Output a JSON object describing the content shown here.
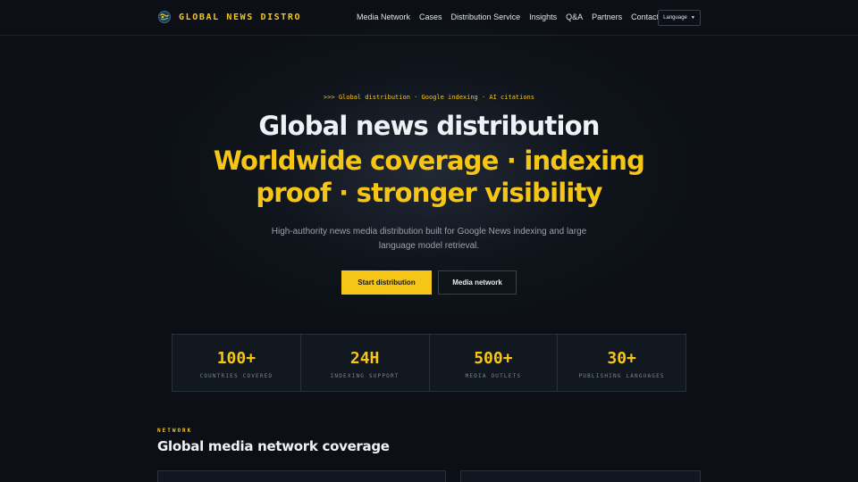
{
  "brand": {
    "name": "GLOBAL NEWS DISTRO",
    "logo_icon": "globe-icon"
  },
  "nav": {
    "items": [
      "Media Network",
      "Cases",
      "Distribution Service",
      "Insights",
      "Q&A",
      "Partners",
      "Contact"
    ],
    "language_label": "Language",
    "language_icon": "caret-down-icon"
  },
  "hero": {
    "eyebrow": ">>> Global distribution · Google indexing · AI citations",
    "title_line1": "Global news distribution",
    "title_line2": "Worldwide coverage · indexing",
    "title_line3": "proof · stronger visibility",
    "subtitle": "High-authority news media distribution built for Google News indexing and large language model retrieval.",
    "primary_button": "Start distribution",
    "secondary_button": "Media network"
  },
  "stats": [
    {
      "value": "100+",
      "label": "COUNTRIES COVERED"
    },
    {
      "value": "24H",
      "label": "INDEXING SUPPORT"
    },
    {
      "value": "500+",
      "label": "MEDIA OUTLETS"
    },
    {
      "value": "30+",
      "label": "PUBLISHING LANGUAGES"
    }
  ],
  "network_section": {
    "eyebrow": "NETWORK",
    "title": "Global media network coverage"
  },
  "colors": {
    "background": "#0c1016",
    "accent": "#f5c518",
    "text": "#eef1f5",
    "muted": "#9aa3ae",
    "border": "#2b313a"
  }
}
